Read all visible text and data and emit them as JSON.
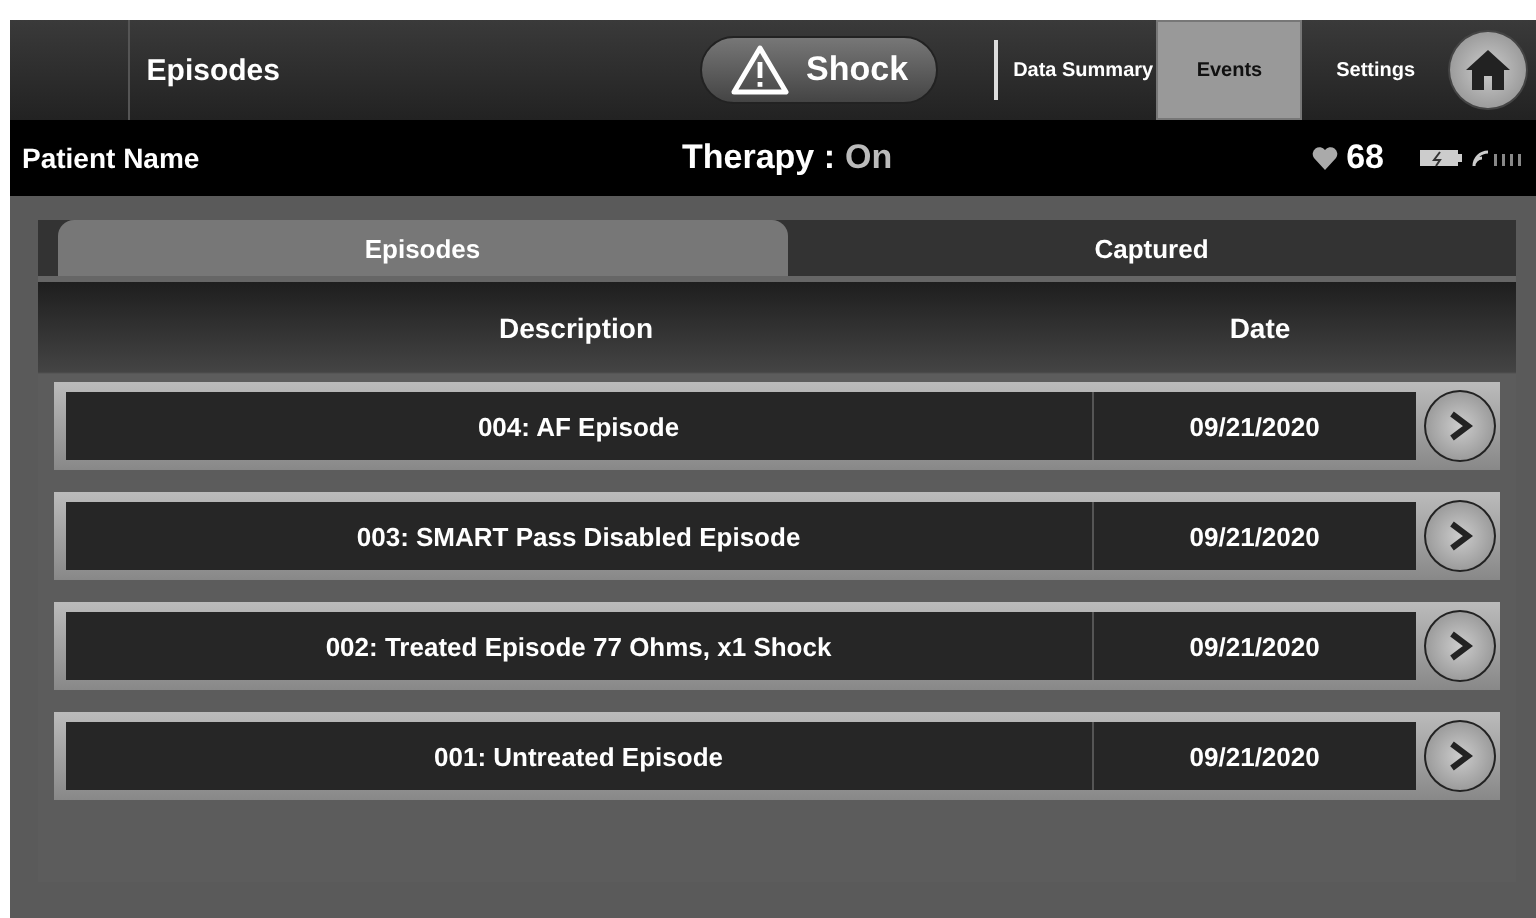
{
  "header": {
    "title": "Episodes",
    "shock_button": "Shock",
    "nav": [
      {
        "label": "Data Summary",
        "selected": false
      },
      {
        "label": "Events",
        "selected": true
      },
      {
        "label": "Settings",
        "selected": false
      }
    ]
  },
  "status_bar": {
    "patient": "Patient Name",
    "therapy_label": "Therapy :",
    "therapy_value": "On",
    "heart_rate": "68"
  },
  "tabs": [
    {
      "label": "Episodes",
      "selected": true
    },
    {
      "label": "Captured",
      "selected": false
    }
  ],
  "table": {
    "columns": [
      "Description",
      "Date"
    ],
    "rows": [
      {
        "description": "004: AF Episode",
        "date": "09/21/2020"
      },
      {
        "description": "003: SMART Pass Disabled Episode",
        "date": "09/21/2020"
      },
      {
        "description": "002: Treated Episode 77 Ohms, x1 Shock",
        "date": "09/21/2020"
      },
      {
        "description": "001: Untreated Episode",
        "date": "09/21/2020"
      }
    ]
  }
}
